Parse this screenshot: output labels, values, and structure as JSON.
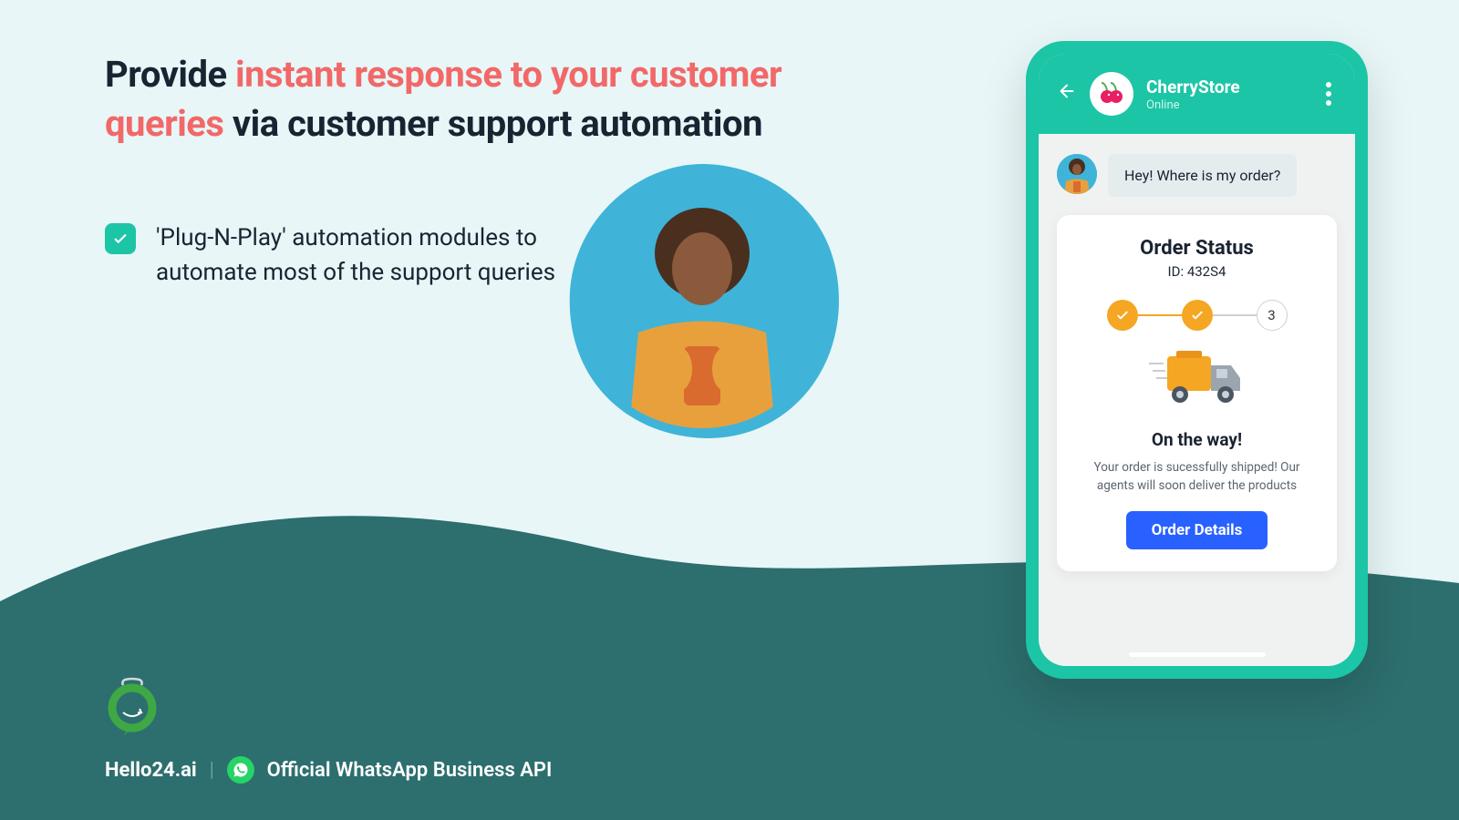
{
  "heading": {
    "part1": "Provide ",
    "accent": "instant response to your customer queries",
    "part2": " via customer support automation"
  },
  "bullet": "'Plug-N-Play' automation modules to automate most of the support queries",
  "phone": {
    "header": {
      "store_name": "CherryStore",
      "status": "Online"
    },
    "user_message": "Hey! Where is my order?",
    "card": {
      "title": "Order Status",
      "id_label": "ID: 432S4",
      "step3_label": "3",
      "status_title": "On the way!",
      "description": "Your order is sucessfully shipped! Our agents will soon deliver the products",
      "button": "Order Details"
    }
  },
  "footer": {
    "brand": "Hello24.ai",
    "divider": "|",
    "tagline": "Official WhatsApp Business API"
  }
}
